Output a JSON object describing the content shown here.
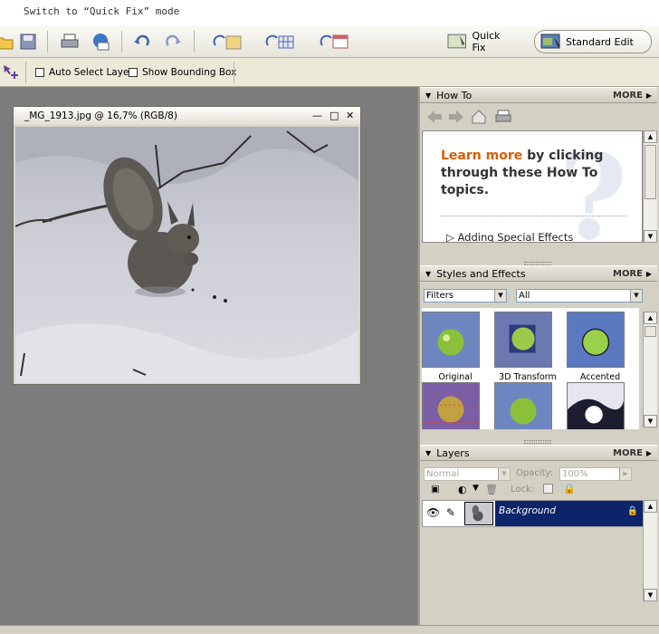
{
  "caption": "Switch to “Quick Fix” mode",
  "toolbar": {
    "buttons": [
      "open-icon",
      "save-icon",
      "print-icon",
      "email-icon",
      "undo-icon",
      "redo-icon",
      "rotate-icon",
      "grid-icon",
      "calendar-icon"
    ],
    "quick_fix_label": "Quick Fix",
    "standard_edit_label": "Standard Edit"
  },
  "options": {
    "auto_select_layer": "Auto Select Layer",
    "show_bounding_box": "Show Bounding Box"
  },
  "document": {
    "title": "_MG_1913.jpg @ 16,7% (RGB/8)"
  },
  "howto": {
    "header": "How To",
    "more": "MORE",
    "learn_more": "Learn more",
    "headline_rest": " by clicking through these How To topics.",
    "topic": "Adding Special Effects"
  },
  "styles": {
    "header": "Styles and Effects",
    "more": "MORE",
    "category": "Filters",
    "filter": "All",
    "thumbnails": [
      {
        "label": "Original"
      },
      {
        "label": "3D Transform"
      },
      {
        "label": "Accented Edges"
      }
    ]
  },
  "layers": {
    "header": "Layers",
    "more": "MORE",
    "blend_mode": "Normal",
    "opacity_label": "Opacity:",
    "opacity": "100%",
    "lock_label": "Lock:",
    "layer_name": "Background"
  },
  "colors": {
    "accent_orange": "#d65e00",
    "selected_layer": "#0b246a"
  }
}
